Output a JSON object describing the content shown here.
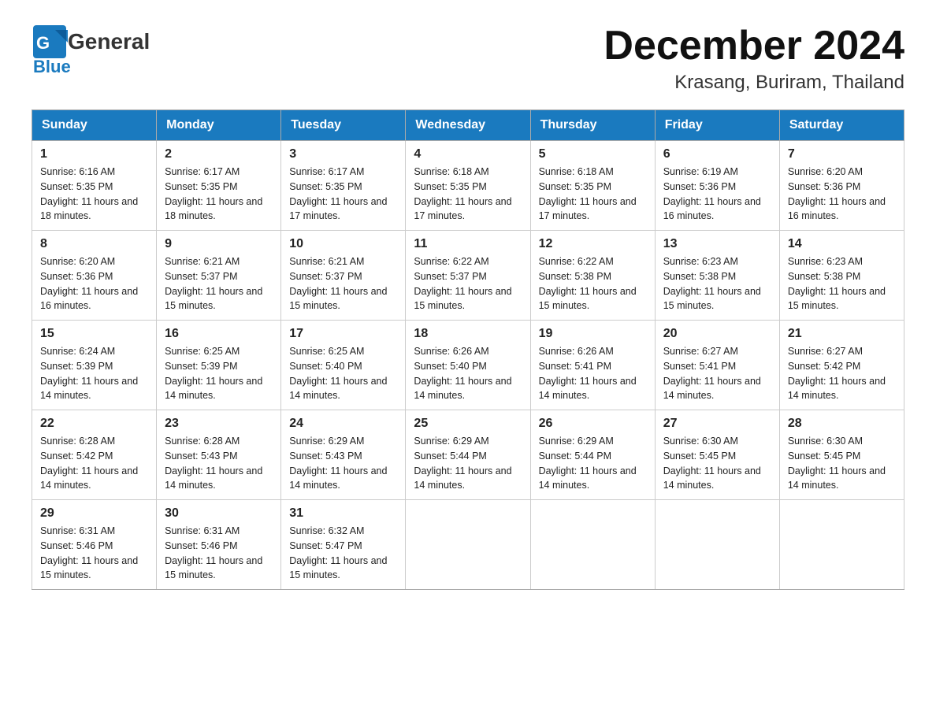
{
  "header": {
    "logo_general": "General",
    "logo_blue": "Blue",
    "title": "December 2024",
    "subtitle": "Krasang, Buriram, Thailand"
  },
  "columns": [
    "Sunday",
    "Monday",
    "Tuesday",
    "Wednesday",
    "Thursday",
    "Friday",
    "Saturday"
  ],
  "weeks": [
    [
      {
        "day": "1",
        "sunrise": "6:16 AM",
        "sunset": "5:35 PM",
        "daylight": "11 hours and 18 minutes."
      },
      {
        "day": "2",
        "sunrise": "6:17 AM",
        "sunset": "5:35 PM",
        "daylight": "11 hours and 18 minutes."
      },
      {
        "day": "3",
        "sunrise": "6:17 AM",
        "sunset": "5:35 PM",
        "daylight": "11 hours and 17 minutes."
      },
      {
        "day": "4",
        "sunrise": "6:18 AM",
        "sunset": "5:35 PM",
        "daylight": "11 hours and 17 minutes."
      },
      {
        "day": "5",
        "sunrise": "6:18 AM",
        "sunset": "5:35 PM",
        "daylight": "11 hours and 17 minutes."
      },
      {
        "day": "6",
        "sunrise": "6:19 AM",
        "sunset": "5:36 PM",
        "daylight": "11 hours and 16 minutes."
      },
      {
        "day": "7",
        "sunrise": "6:20 AM",
        "sunset": "5:36 PM",
        "daylight": "11 hours and 16 minutes."
      }
    ],
    [
      {
        "day": "8",
        "sunrise": "6:20 AM",
        "sunset": "5:36 PM",
        "daylight": "11 hours and 16 minutes."
      },
      {
        "day": "9",
        "sunrise": "6:21 AM",
        "sunset": "5:37 PM",
        "daylight": "11 hours and 15 minutes."
      },
      {
        "day": "10",
        "sunrise": "6:21 AM",
        "sunset": "5:37 PM",
        "daylight": "11 hours and 15 minutes."
      },
      {
        "day": "11",
        "sunrise": "6:22 AM",
        "sunset": "5:37 PM",
        "daylight": "11 hours and 15 minutes."
      },
      {
        "day": "12",
        "sunrise": "6:22 AM",
        "sunset": "5:38 PM",
        "daylight": "11 hours and 15 minutes."
      },
      {
        "day": "13",
        "sunrise": "6:23 AM",
        "sunset": "5:38 PM",
        "daylight": "11 hours and 15 minutes."
      },
      {
        "day": "14",
        "sunrise": "6:23 AM",
        "sunset": "5:38 PM",
        "daylight": "11 hours and 15 minutes."
      }
    ],
    [
      {
        "day": "15",
        "sunrise": "6:24 AM",
        "sunset": "5:39 PM",
        "daylight": "11 hours and 14 minutes."
      },
      {
        "day": "16",
        "sunrise": "6:25 AM",
        "sunset": "5:39 PM",
        "daylight": "11 hours and 14 minutes."
      },
      {
        "day": "17",
        "sunrise": "6:25 AM",
        "sunset": "5:40 PM",
        "daylight": "11 hours and 14 minutes."
      },
      {
        "day": "18",
        "sunrise": "6:26 AM",
        "sunset": "5:40 PM",
        "daylight": "11 hours and 14 minutes."
      },
      {
        "day": "19",
        "sunrise": "6:26 AM",
        "sunset": "5:41 PM",
        "daylight": "11 hours and 14 minutes."
      },
      {
        "day": "20",
        "sunrise": "6:27 AM",
        "sunset": "5:41 PM",
        "daylight": "11 hours and 14 minutes."
      },
      {
        "day": "21",
        "sunrise": "6:27 AM",
        "sunset": "5:42 PM",
        "daylight": "11 hours and 14 minutes."
      }
    ],
    [
      {
        "day": "22",
        "sunrise": "6:28 AM",
        "sunset": "5:42 PM",
        "daylight": "11 hours and 14 minutes."
      },
      {
        "day": "23",
        "sunrise": "6:28 AM",
        "sunset": "5:43 PM",
        "daylight": "11 hours and 14 minutes."
      },
      {
        "day": "24",
        "sunrise": "6:29 AM",
        "sunset": "5:43 PM",
        "daylight": "11 hours and 14 minutes."
      },
      {
        "day": "25",
        "sunrise": "6:29 AM",
        "sunset": "5:44 PM",
        "daylight": "11 hours and 14 minutes."
      },
      {
        "day": "26",
        "sunrise": "6:29 AM",
        "sunset": "5:44 PM",
        "daylight": "11 hours and 14 minutes."
      },
      {
        "day": "27",
        "sunrise": "6:30 AM",
        "sunset": "5:45 PM",
        "daylight": "11 hours and 14 minutes."
      },
      {
        "day": "28",
        "sunrise": "6:30 AM",
        "sunset": "5:45 PM",
        "daylight": "11 hours and 14 minutes."
      }
    ],
    [
      {
        "day": "29",
        "sunrise": "6:31 AM",
        "sunset": "5:46 PM",
        "daylight": "11 hours and 15 minutes."
      },
      {
        "day": "30",
        "sunrise": "6:31 AM",
        "sunset": "5:46 PM",
        "daylight": "11 hours and 15 minutes."
      },
      {
        "day": "31",
        "sunrise": "6:32 AM",
        "sunset": "5:47 PM",
        "daylight": "11 hours and 15 minutes."
      },
      null,
      null,
      null,
      null
    ]
  ]
}
